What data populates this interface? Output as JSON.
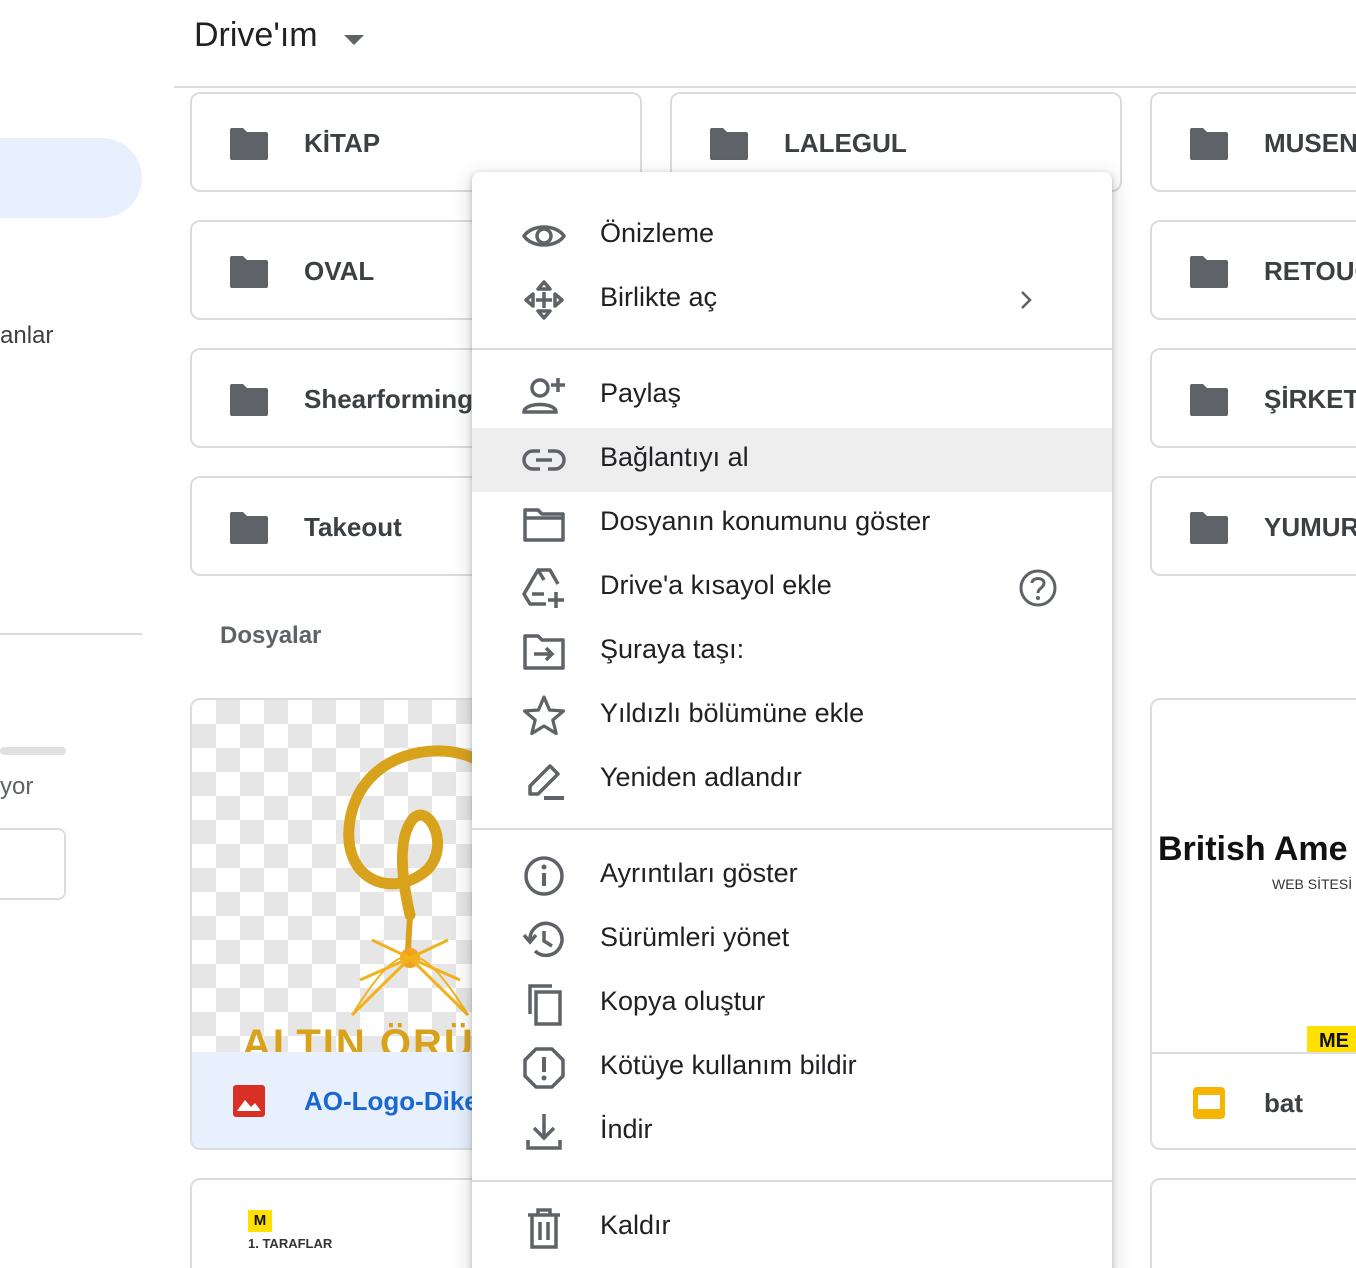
{
  "header": {
    "title": "Drive'ım"
  },
  "sidebar": {
    "partial_label_1": "anlar",
    "partial_label_2": "yor"
  },
  "folders": [
    {
      "name": "KİTAP"
    },
    {
      "name": "LALEGUL"
    },
    {
      "name": "MUSENI"
    },
    {
      "name": "OVAL"
    },
    {
      "name": "RETOUC"
    },
    {
      "name": "Shearforming"
    },
    {
      "name": "ŞİRKET"
    },
    {
      "name": "Takeout"
    },
    {
      "name": "YUMURT"
    }
  ],
  "files_section": {
    "label": "Dosyalar"
  },
  "files": [
    {
      "name": "AO-Logo-Dikey",
      "thumb_text": "ALTIN ÖRÜ",
      "type_icon": "image-icon"
    },
    {
      "name": "bat",
      "thumb_title": "British Ame",
      "thumb_subtitle": "WEB SİTESİ",
      "thumb_tag": "ME",
      "type_icon": "slides-icon"
    },
    {
      "thumb_badge": "M",
      "thumb_caption": "1. TARAFLAR"
    }
  ],
  "context_menu": {
    "items": [
      {
        "label": "Önizleme",
        "icon": "eye-icon"
      },
      {
        "label": "Birlikte aç",
        "icon": "open-with-icon",
        "submenu": true
      },
      {
        "label": "Paylaş",
        "icon": "person-add-icon"
      },
      {
        "label": "Bağlantıyı al",
        "icon": "link-icon",
        "highlighted": true
      },
      {
        "label": "Dosyanın konumunu göster",
        "icon": "folder-outline-icon"
      },
      {
        "label": "Drive'a kısayol ekle",
        "icon": "drive-shortcut-icon",
        "help": true
      },
      {
        "label": "Şuraya taşı:",
        "icon": "move-to-folder-icon"
      },
      {
        "label": "Yıldızlı bölümüne ekle",
        "icon": "star-icon"
      },
      {
        "label": "Yeniden adlandır",
        "icon": "pencil-icon"
      },
      {
        "label": "Ayrıntıları göster",
        "icon": "info-icon"
      },
      {
        "label": "Sürümleri yönet",
        "icon": "history-icon"
      },
      {
        "label": "Kopya oluştur",
        "icon": "copy-icon"
      },
      {
        "label": "Kötüye kullanım bildir",
        "icon": "report-icon"
      },
      {
        "label": "İndir",
        "icon": "download-icon"
      },
      {
        "label": "Kaldır",
        "icon": "trash-icon"
      }
    ]
  },
  "colors": {
    "accent_blue": "#1967d2",
    "selection_bg": "#e8f0fe",
    "folder_icon": "#5f6368",
    "menu_highlight": "#eeeeee",
    "image_icon_red": "#d93025",
    "slides_icon_yellow": "#f4b400"
  }
}
